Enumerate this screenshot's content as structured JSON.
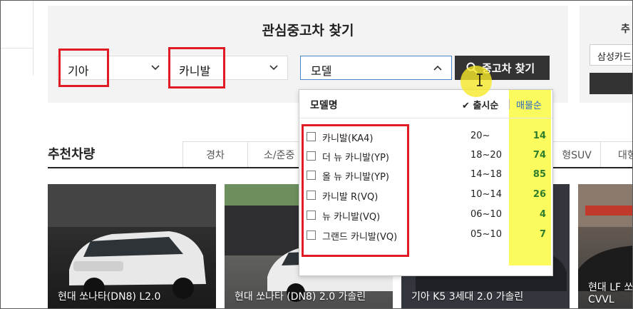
{
  "search": {
    "title": "관심중고차 찾기",
    "brand": "기아",
    "model": "카니발",
    "detail": "모델",
    "button": "중고차 찾기"
  },
  "right_panel": {
    "title": "추",
    "select_value": "삼성카드"
  },
  "dropdown": {
    "header_name": "모델명",
    "sort_release": "출시순",
    "sort_sales": "매물순",
    "rows": [
      {
        "name": "카니발(KA4)",
        "years": "20~",
        "count": "14"
      },
      {
        "name": "더 뉴 카니발(YP)",
        "years": "18~20",
        "count": "74"
      },
      {
        "name": "올 뉴 카니발(YP)",
        "years": "14~18",
        "count": "85"
      },
      {
        "name": "카니발 R(VQ)",
        "years": "10~14",
        "count": "26"
      },
      {
        "name": "뉴 카니발(VQ)",
        "years": "06~10",
        "count": "4"
      },
      {
        "name": "그랜드 카니발(VQ)",
        "years": "05~10",
        "count": "7"
      }
    ]
  },
  "recommend": {
    "title": "추천차량",
    "tabs": [
      "경차",
      "소/준중",
      "형SUV",
      "대형"
    ],
    "cards": [
      {
        "caption": "현대 쏘나타(DN8) L2.0"
      },
      {
        "caption": "현대 쏘나타 (DN8) 2.0 가솔린"
      },
      {
        "caption": "기아 K5 3세대 2.0 가솔린"
      },
      {
        "caption_line1": "현대 LF 쏘",
        "caption_line2": "CVVL"
      }
    ]
  },
  "colors": {
    "highlight_border": "#e01b23",
    "sales_highlight": "#fbfb5e",
    "count_text": "#2f7d2c",
    "sort_active": "#2b6ac4",
    "button_bg": "#333333"
  }
}
